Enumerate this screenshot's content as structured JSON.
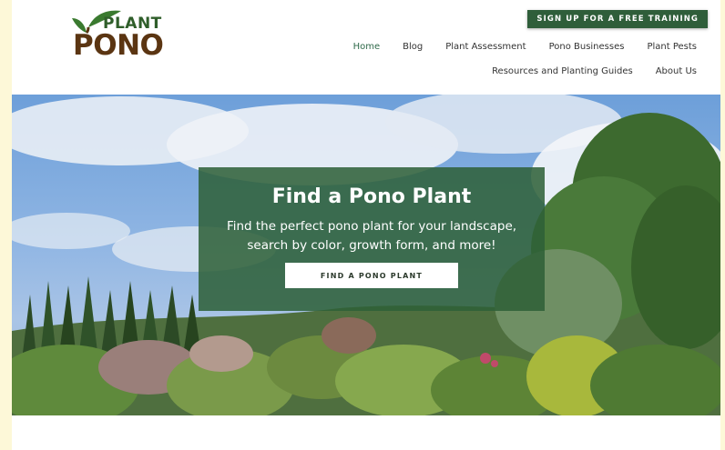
{
  "header": {
    "logo": {
      "line1": "PLANT",
      "line2": "PONO"
    },
    "signup_label": "SIGN UP FOR A FREE TRAINING",
    "nav_row1": [
      "Home",
      "Blog",
      "Plant Assessment",
      "Pono Businesses",
      "Plant Pests"
    ],
    "nav_row2": [
      "Resources and Planting Guides",
      "About Us"
    ],
    "active_item": "Home"
  },
  "hero": {
    "title": "Find a Pono Plant",
    "subtitle": "Find the perfect pono plant for your landscape, search by color, growth form, and more!",
    "button_label": "FIND A PONO PLANT"
  },
  "colors": {
    "page_margin": "#fdf8d8",
    "brand_green": "#2f5e3a",
    "logo_brown": "#5b3512",
    "overlay": "#2d5f37"
  }
}
